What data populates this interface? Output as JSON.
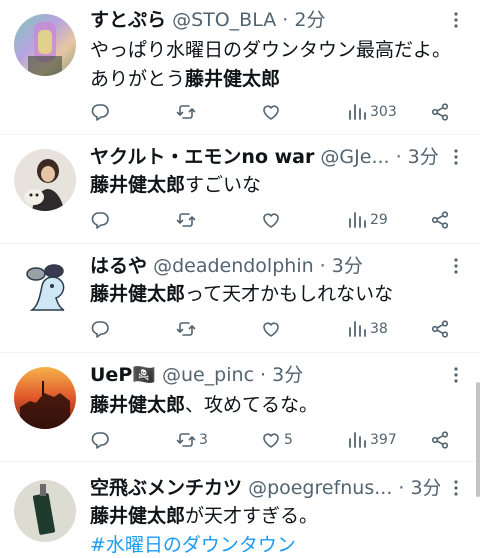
{
  "tweets": [
    {
      "name": "すとぷら",
      "meta": "@STO_BLA · 2分",
      "line1": "やっぱり水曜日のダウンタウン最高だよ。",
      "line2_plain": "ありがとう",
      "line2_bold": "藤井健太郎",
      "reply_count": "",
      "retweet_count": "",
      "like_count": "",
      "view_count": "303"
    },
    {
      "name": "ヤクルト・エモンno war",
      "meta": "@GJe... · 3分",
      "bold": "藤井健太郎",
      "plain": "すごいな",
      "reply_count": "",
      "retweet_count": "",
      "like_count": "",
      "view_count": "29"
    },
    {
      "name": "はるや",
      "meta": "@deadendolphin · 3分",
      "bold": "藤井健太郎",
      "plain": "って天才かもしれないな",
      "reply_count": "",
      "retweet_count": "",
      "like_count": "",
      "view_count": "38"
    },
    {
      "name": "UeP🏴‍☠️",
      "meta": "@ue_pinc · 3分",
      "bold": "藤井健太郎",
      "plain": "、攻めてるな。",
      "reply_count": "",
      "retweet_count": "3",
      "like_count": "5",
      "view_count": "397"
    },
    {
      "name": "空飛ぶメンチカツ",
      "meta": "@poegrefnus... · 3分",
      "bold": "藤井健太郎",
      "plain": "が天才すぎる。",
      "hashtag": "#水曜日のダウンタウン"
    }
  ],
  "icons": {
    "reply": "reply-icon",
    "retweet": "retweet-icon",
    "like": "like-icon",
    "views": "views-icon",
    "share": "share-icon",
    "more": "more-icon"
  },
  "colors": {
    "text": "#0f1419",
    "muted": "#536471",
    "link": "#1d9bf0",
    "divider": "#eff3f4"
  }
}
